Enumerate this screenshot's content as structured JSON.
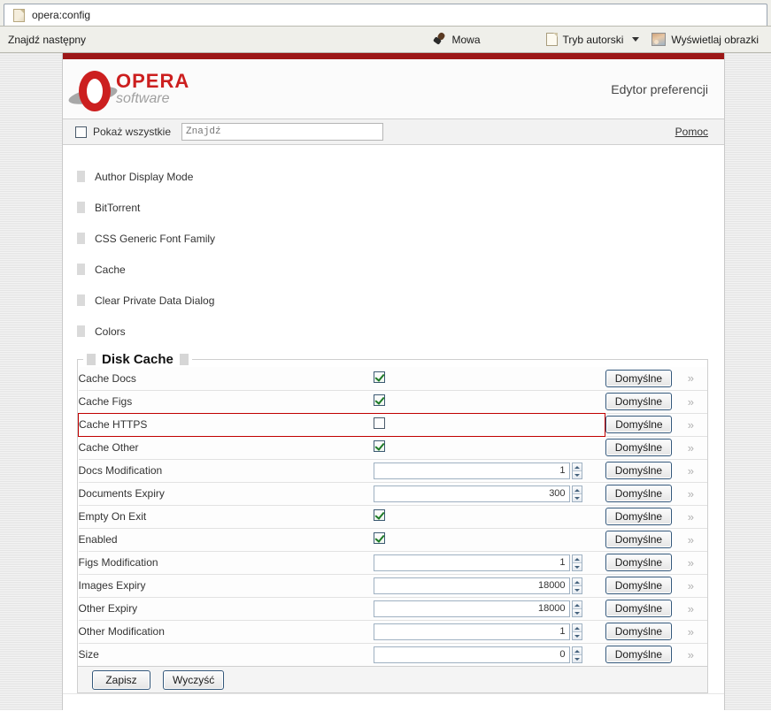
{
  "browser": {
    "tab": {
      "title": "opera:config",
      "icon": "document-icon"
    },
    "toolbar": {
      "find_next": "Znajdź następny",
      "speech": {
        "label": "Mowa",
        "icon": "microphone-icon"
      },
      "author_mode": {
        "label": "Tryb autorski",
        "icon": "page-icon",
        "dropdown_icon": "chevron-down-icon"
      },
      "show_images": {
        "label": "Wyświetlaj obrazki",
        "icon": "image-icon"
      }
    }
  },
  "page": {
    "brand": {
      "name": "OPERA",
      "tagline": "software",
      "logo_color": "#cc1f1f"
    },
    "title": "Edytor preferencji",
    "accent_bar_color": "#9c1717",
    "search": {
      "show_all_label": "Pokaż wszystkie",
      "show_all_checked": false,
      "find_placeholder": "Znajdź",
      "find_value": "",
      "help_label": "Pomoc"
    },
    "sections": [
      {
        "label": "Author Display Mode"
      },
      {
        "label": "BitTorrent"
      },
      {
        "label": "CSS Generic Font Family"
      },
      {
        "label": "Cache"
      },
      {
        "label": "Clear Private Data Dialog"
      },
      {
        "label": "Colors"
      }
    ],
    "group": {
      "legend": "Disk Cache",
      "default_button_label": "Domyślne",
      "more_glyph": "»",
      "rows": [
        {
          "name": "Cache Docs",
          "type": "checkbox",
          "checked": true,
          "highlighted": false
        },
        {
          "name": "Cache Figs",
          "type": "checkbox",
          "checked": true,
          "highlighted": false
        },
        {
          "name": "Cache HTTPS",
          "type": "checkbox",
          "checked": false,
          "highlighted": true
        },
        {
          "name": "Cache Other",
          "type": "checkbox",
          "checked": true,
          "highlighted": false
        },
        {
          "name": "Docs Modification",
          "type": "number",
          "value": "1",
          "highlighted": false
        },
        {
          "name": "Documents Expiry",
          "type": "number",
          "value": "300",
          "highlighted": false
        },
        {
          "name": "Empty On Exit",
          "type": "checkbox",
          "checked": true,
          "highlighted": false
        },
        {
          "name": "Enabled",
          "type": "checkbox",
          "checked": true,
          "highlighted": false
        },
        {
          "name": "Figs Modification",
          "type": "number",
          "value": "1",
          "highlighted": false
        },
        {
          "name": "Images Expiry",
          "type": "number",
          "value": "18000",
          "highlighted": false
        },
        {
          "name": "Other Expiry",
          "type": "number",
          "value": "18000",
          "highlighted": false
        },
        {
          "name": "Other Modification",
          "type": "number",
          "value": "1",
          "highlighted": false
        },
        {
          "name": "Size",
          "type": "number",
          "value": "0",
          "highlighted": false
        }
      ]
    },
    "footer": {
      "save_label": "Zapisz",
      "clear_label": "Wyczyść"
    }
  }
}
